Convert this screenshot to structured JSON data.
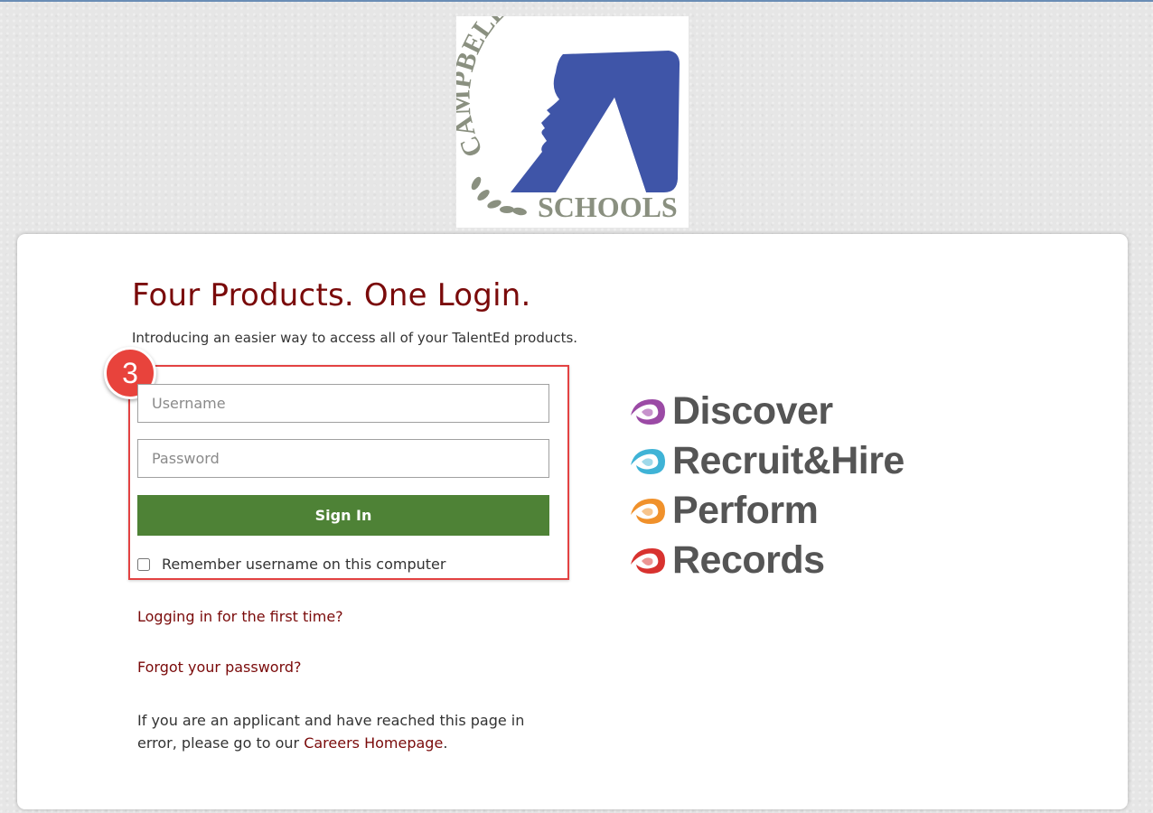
{
  "logo": {
    "top_text": "CAMPBELL COUNTY",
    "bottom_text": "SCHOOLS",
    "colors": {
      "silhouette": "#3f55a8",
      "text": "#8a9080"
    }
  },
  "card": {
    "headline": "Four Products. One Login.",
    "subline": "Introducing an easier way to access all of your TalentEd products."
  },
  "annotation": {
    "badge_number": "3",
    "color": "#e8433c"
  },
  "form": {
    "username_placeholder": "Username",
    "password_placeholder": "Password",
    "signin_label": "Sign In",
    "remember_label": "Remember username on this computer",
    "remember_checked": false
  },
  "links": {
    "first_time": "Logging in for the first time?",
    "forgot_password": "Forgot your password?",
    "applicant_prefix": "If you are an applicant and have reached this page in error, please go to our ",
    "careers_link": "Careers Homepage",
    "applicant_suffix": "."
  },
  "products": [
    {
      "name": "Discover",
      "color": "#9b4aa5",
      "icon": "discover-swirl-icon"
    },
    {
      "name": "Recruit&Hire",
      "color": "#3fb3d6",
      "icon": "recruit-hire-swirl-icon"
    },
    {
      "name": "Perform",
      "color": "#f0912b",
      "icon": "perform-swirl-icon"
    },
    {
      "name": "Records",
      "color": "#d8322f",
      "icon": "records-swirl-icon"
    }
  ],
  "theme": {
    "accent": "#7a0a0a",
    "signin_button": "#4e8236",
    "highlight_box": "#e34242"
  }
}
